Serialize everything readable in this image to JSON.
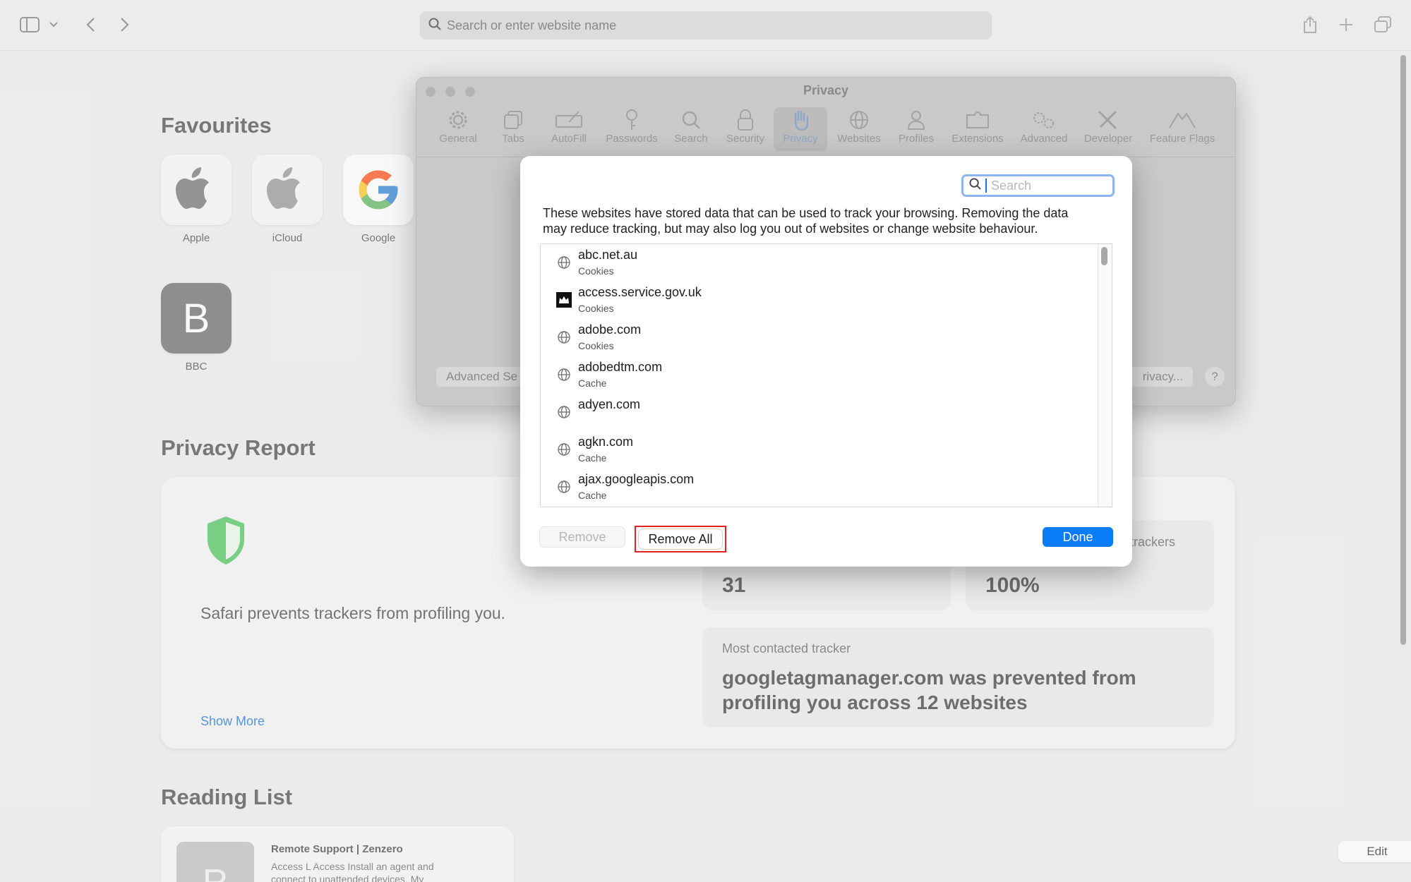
{
  "toolbar": {
    "search_placeholder": "Search or enter website name",
    "icons": [
      "sidebar-icon",
      "chevron-down-icon",
      "back-icon",
      "forward-icon",
      "search-icon",
      "share-icon",
      "new-tab-icon",
      "tab-overview-icon"
    ]
  },
  "favourites": {
    "title": "Favourites",
    "items": [
      {
        "label": "Apple",
        "icon": "apple-logo-icon"
      },
      {
        "label": "iCloud",
        "icon": "apple-logo-icon"
      },
      {
        "label": "Google",
        "icon": "google-logo-icon"
      },
      {
        "label": "BBC",
        "letter": "B"
      }
    ]
  },
  "privacy_report": {
    "title": "Privacy Report",
    "message": "Safari prevents trackers from profiling you.",
    "show_more": "Show More",
    "stat_left_value": "31",
    "stat_right_label": "trackers",
    "stat_right_value": "100%",
    "tracker_label": "Most contacted tracker",
    "tracker_text_line1": "googletagmanager.com was prevented from",
    "tracker_text_line2": "profiling you across 12 websites"
  },
  "reading_list": {
    "title": "Reading List",
    "item_title": "Remote Support | Zenzero",
    "item_desc_line1": "Access L Access Install an agent and",
    "item_desc_line2": "connect to unattended devices. My",
    "item_thumb_letter": "R",
    "edit": "Edit"
  },
  "settings_window": {
    "title": "Privacy",
    "tabs": [
      "General",
      "Tabs",
      "AutoFill",
      "Passwords",
      "Search",
      "Security",
      "Privacy",
      "Websites",
      "Profiles",
      "Extensions",
      "Advanced",
      "Developer",
      "Feature Flags"
    ],
    "active_tab": "Privacy",
    "advanced_button": "Advanced Se",
    "privacy_button": "rivacy...",
    "help": "?"
  },
  "sheet": {
    "search_placeholder": "Search",
    "description_line1": "These websites have stored data that can be used to track your browsing. Removing the data",
    "description_line2": "may reduce tracking, but may also log you out of websites or change website behaviour.",
    "rows": [
      {
        "name": "abc.net.au",
        "type": "Cookies",
        "icon": "globe-icon"
      },
      {
        "name": "access.service.gov.uk",
        "type": "Cookies",
        "icon": "gov-crown-icon"
      },
      {
        "name": "adobe.com",
        "type": "Cookies",
        "icon": "globe-icon"
      },
      {
        "name": "adobedtm.com",
        "type": "Cache",
        "icon": "globe-icon"
      },
      {
        "name": "adyen.com",
        "type": "",
        "icon": "globe-icon"
      },
      {
        "name": "agkn.com",
        "type": "Cache",
        "icon": "globe-icon"
      },
      {
        "name": "ajax.googleapis.com",
        "type": "Cache",
        "icon": "globe-icon"
      }
    ],
    "remove": "Remove",
    "remove_all": "Remove All",
    "done": "Done"
  },
  "colors": {
    "accent": "#0a7cf8",
    "highlight_box": "#e0241d",
    "link": "#0a66d8",
    "shield_green": "#3bbf4a"
  }
}
